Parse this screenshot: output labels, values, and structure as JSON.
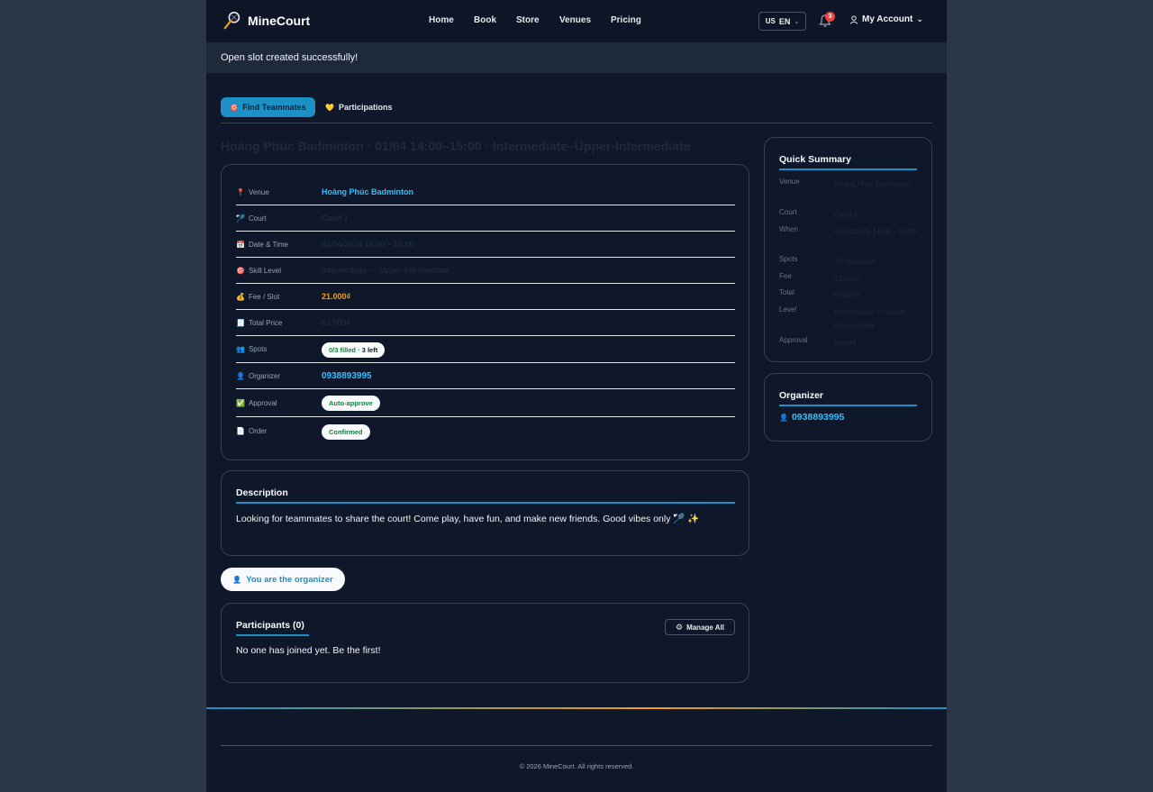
{
  "brand": {
    "name": "MineCourt",
    "accent": "#1d90c6",
    "warning": "#f59e0b"
  },
  "nav": {
    "links": [
      "Home",
      "Book",
      "Store",
      "Venues",
      "Pricing"
    ],
    "lang_flag": "US",
    "lang_code": "EN",
    "notifications": "3",
    "account_label": "My Account"
  },
  "flash": {
    "message": "Open slot created successfully!"
  },
  "tabs": {
    "find_teammates": "Find Teammates",
    "participations": "Participations"
  },
  "page": {
    "title": "Hoàng Phúc Badminton · 01/04 14:00–15:00 · Intermediate–Upper-Intermediate"
  },
  "details": {
    "venue_label": "Venue",
    "venue": "Hoàng Phúc Badminton",
    "court_label": "Court",
    "court": "Court 1",
    "datetime_label": "Date & Time",
    "datetime": "01/04/2026 14:00 – 15:00",
    "skill_label": "Skill Level",
    "skill": "Intermediate — Upper-Intermediate",
    "fee_label": "Fee / Slot",
    "fee": "21.000₫",
    "total_label": "Total Price",
    "total": "63.000₫",
    "spots_label": "Spots",
    "spots_filled": "0/3 filled · ",
    "spots_left": "3 left",
    "organizer_label": "Organizer",
    "organizer": "0938893995",
    "approval_label": "Approval",
    "approval": "Auto-approve",
    "order_label": "Order",
    "order": "Confirmed"
  },
  "description": {
    "title": "Description",
    "text": "Looking for teammates to share the court! Come play, have fun, and make new friends. Good vibes only 🏸 ✨"
  },
  "organizer_badge": "You are the organizer",
  "participants": {
    "title": "Participants (0)",
    "manage_label": "Manage All",
    "empty_text": "No one has joined yet. Be the first!"
  },
  "quick_summary": {
    "title": "Quick Summary",
    "rows": [
      {
        "k": "Venue",
        "v": "Hoàng Phúc Badminton"
      },
      {
        "k": "Court",
        "v": "Court 1"
      },
      {
        "k": "When",
        "v": "01/04/2026 14:00 – 15:00"
      },
      {
        "k": "Spots",
        "v": "3/3 available"
      },
      {
        "k": "Fee",
        "v": "21.000₫"
      },
      {
        "k": "Total",
        "v": "63.000₫"
      },
      {
        "k": "Level",
        "v": "Intermediate — Upper-Intermediate"
      },
      {
        "k": "Approval",
        "v": "Instant"
      }
    ]
  },
  "organizer_card": {
    "title": "Organizer",
    "phone": "0938893995"
  },
  "footer": {
    "copyright": "© 2026 MineCourt. All rights reserved."
  }
}
